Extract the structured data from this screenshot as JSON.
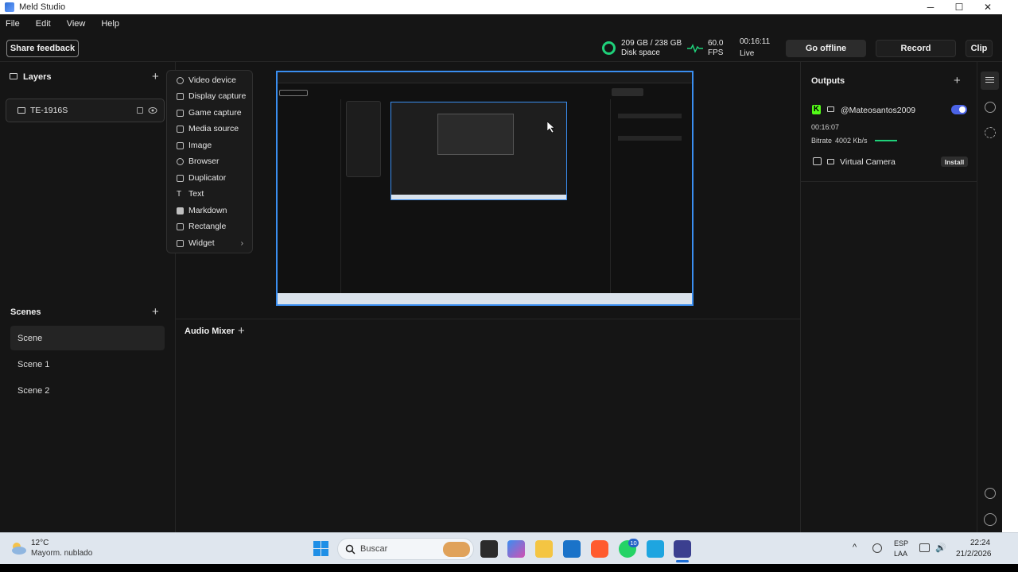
{
  "window": {
    "title": "Meld Studio"
  },
  "menu": [
    "File",
    "Edit",
    "View",
    "Help"
  ],
  "toolbar": {
    "share_feedback": "Share feedback",
    "disk": {
      "value": "209 GB / 238 GB",
      "label": "Disk space"
    },
    "fps": {
      "value": "60.0",
      "label": "FPS"
    },
    "live": {
      "time": "00:16:11",
      "label": "Live"
    },
    "go_offline": "Go offline",
    "record": "Record",
    "clip": "Clip"
  },
  "layers": {
    "title": "Layers",
    "items": [
      {
        "name": "TE-1916S"
      }
    ]
  },
  "add_layer_menu": [
    {
      "label": "Video device",
      "icon": "camera-icon"
    },
    {
      "label": "Display capture",
      "icon": "monitor-icon"
    },
    {
      "label": "Game capture",
      "icon": "gamepad-icon"
    },
    {
      "label": "Media source",
      "icon": "film-icon"
    },
    {
      "label": "Image",
      "icon": "image-icon"
    },
    {
      "label": "Browser",
      "icon": "globe-icon"
    },
    {
      "label": "Duplicator",
      "icon": "copy-icon"
    },
    {
      "label": "Text",
      "icon": "text-icon"
    },
    {
      "label": "Markdown",
      "icon": "markdown-icon"
    },
    {
      "label": "Rectangle",
      "icon": "rectangle-icon"
    },
    {
      "label": "Widget",
      "icon": "widget-icon"
    }
  ],
  "scenes": {
    "title": "Scenes",
    "items": [
      {
        "name": "Scene"
      },
      {
        "name": "Scene 1"
      },
      {
        "name": "Scene 2"
      }
    ]
  },
  "audio_mixer": {
    "title": "Audio Mixer"
  },
  "outputs": {
    "title": "Outputs",
    "stream": {
      "name": "@Mateosantos2009",
      "time": "00:16:07",
      "bitrate_label": "Bitrate",
      "bitrate_value": "4002 Kb/s",
      "enabled": true
    },
    "virtual_camera": {
      "name": "Virtual Camera",
      "install": "Install"
    }
  },
  "taskbar": {
    "weather": {
      "temp": "12°C",
      "desc": "Mayorm. nublado"
    },
    "search_placeholder": "Buscar",
    "whatsapp_badge": "10",
    "language": {
      "line1": "ESP",
      "line2": "LAA"
    },
    "clock": {
      "time": "22:24",
      "date": "21/2/2026"
    }
  },
  "colors": {
    "accent_blue": "#3a8ef0",
    "live_green": "#1fd17a",
    "toggle_blue": "#4b63e6"
  }
}
